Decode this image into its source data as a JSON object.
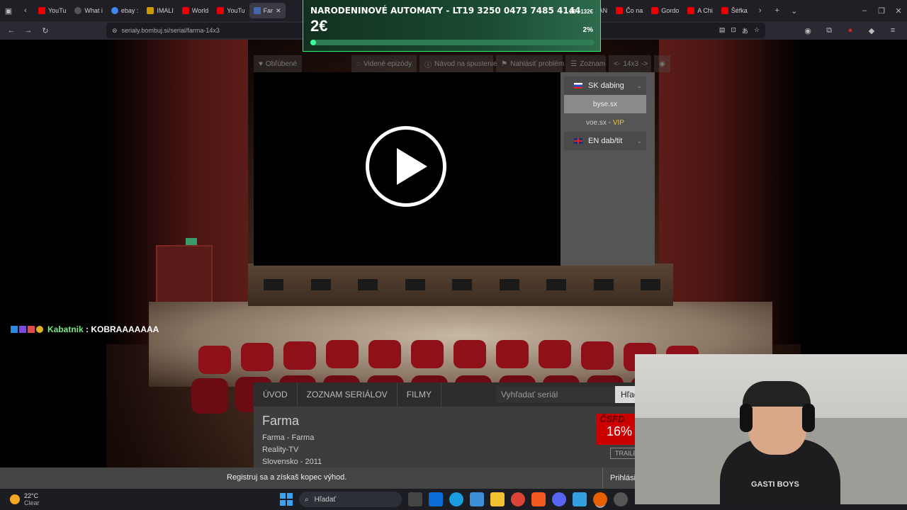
{
  "browser": {
    "tabs": [
      {
        "label": "YouTu",
        "icon": "youtube-icon",
        "color": "#e00"
      },
      {
        "label": "What i",
        "icon": "tab-icon",
        "color": "#555"
      },
      {
        "label": "ebay :",
        "icon": "google-icon",
        "color": "#4285f4"
      },
      {
        "label": "IMALI",
        "icon": "tab-icon",
        "color": "#c90"
      },
      {
        "label": "World",
        "icon": "youtube-icon",
        "color": "#e00"
      },
      {
        "label": "YouTu",
        "icon": "youtube-icon",
        "color": "#e00"
      },
      {
        "label": "Far",
        "icon": "bombuj-icon",
        "color": "#46a"
      },
      {
        "label": "EAN",
        "icon": "tab-icon",
        "color": "#777"
      },
      {
        "label": "Čo na",
        "icon": "youtube-icon",
        "color": "#e00"
      },
      {
        "label": "Gordo",
        "icon": "youtube-icon",
        "color": "#e00"
      },
      {
        "label": "A Chi",
        "icon": "youtube-icon",
        "color": "#e00"
      },
      {
        "label": "Šéfka",
        "icon": "youtube-icon",
        "color": "#e00"
      }
    ],
    "url": "serialy.bombuj.si/serial/farma-14x3"
  },
  "donation": {
    "title": "NARODENINOVÉ AUTOMATY - LT19 3250 0473 7485 4144",
    "amount": "2€",
    "goal": "2€ / 132€",
    "percent": "2%",
    "progress": 0.02
  },
  "player_toolbar": {
    "favorites": "Obľúbené",
    "seen": "Videné epizódy",
    "guide": "Návod na spustenie",
    "report": "Nahlásiť problém",
    "list": "Zoznam",
    "prev": "<-",
    "episode": "14x3",
    "next": "->"
  },
  "sources": {
    "sk_label": "SK dabing",
    "source1": "byse.sx",
    "source2": "voe.sx",
    "source2_sep": " - ",
    "source2_vip": "VIP",
    "en_label": "EN dab/tit"
  },
  "chat": {
    "user": "Kabatnik",
    "message": " : KOBRAAAAAAA"
  },
  "site_nav": {
    "home": "ÚVOD",
    "series_list": "ZOZNAM SERIÁLOV",
    "movies": "FILMY",
    "search_placeholder": "Vyhľadať seriál",
    "search_button": "Hľadať"
  },
  "show": {
    "title": "Farma",
    "subtitle": "Farma - Farma",
    "genre": "Reality-TV",
    "origin": "Slovensko - 2011",
    "rating_logo": "ČSFD",
    "rating": "16%",
    "trailer": "TRAILER"
  },
  "banner": {
    "text": "Registruj sa a získaš kopec výhod.",
    "login": "Prihlásiť"
  },
  "taskbar": {
    "temp": "22°C",
    "weather": "Clear",
    "search": "Hľadať"
  },
  "webcam": {
    "shirt_text": "GASTI BOYS"
  }
}
